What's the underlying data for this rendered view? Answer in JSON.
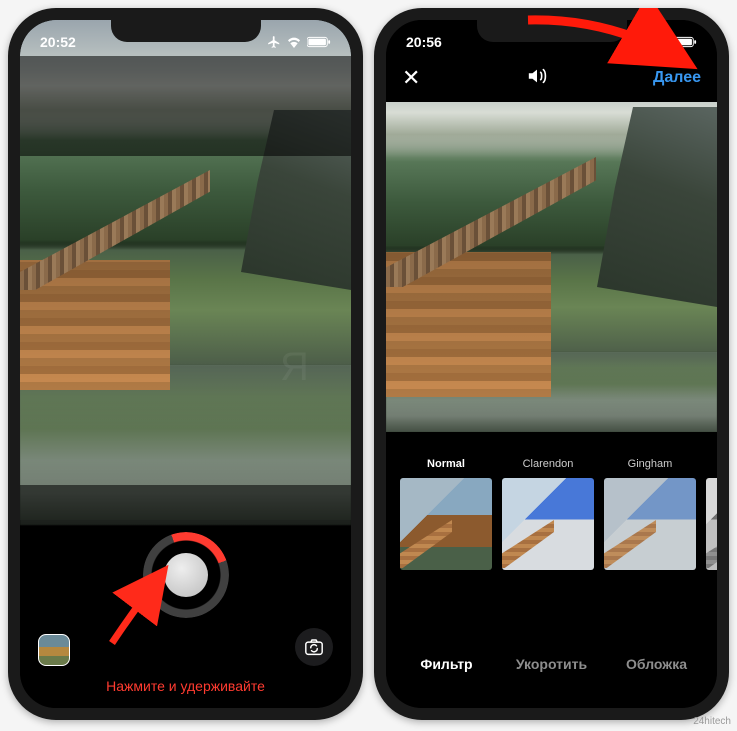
{
  "left": {
    "time": "20:52",
    "hint": "Нажмите и удерживайте"
  },
  "right": {
    "time": "20:56",
    "close": "✕",
    "next": "Далее",
    "filters": {
      "f0": "Normal",
      "f1": "Clarendon",
      "f2": "Gingham",
      "f3": ""
    },
    "tabs": {
      "filter": "Фильтр",
      "trim": "Укоротить",
      "cover": "Обложка"
    }
  },
  "attribution": "24hitech"
}
